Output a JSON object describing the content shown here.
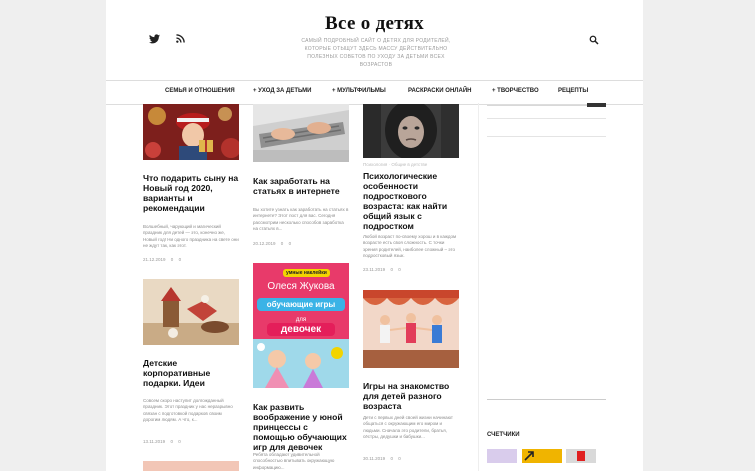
{
  "site": {
    "title": "Все о детях",
    "tagline": "Самый подробный сайт о детях для родителей, которые отыщут здесь массу действительно полезных советов по уходу за детьми всех возрастов"
  },
  "header_icons": [
    "twitter-icon",
    "rss-icon",
    "search-icon"
  ],
  "nav": [
    "Семья и отношения",
    "+ Уход за детьми",
    "+ Мультфильмы",
    "Раскраски онлайн",
    "+ Творчество",
    "Рецепты"
  ],
  "cards": [
    {
      "category": "",
      "title": "Что подарить сыну на Новый год 2020, варианты и рекомендации",
      "excerpt": "Волшебный, чарующий и магический праздник для детей — это, конечно же, Новый год! Ни одного праздника на свете они не ждут так, как этот.",
      "date": "21.12.2019",
      "comments": "0",
      "likes": "0"
    },
    {
      "category": "",
      "title": "Как заработать на статьях в интернете",
      "excerpt": "Вы хотите узнать как заработать на статьях в интернете? Этот пост для вас. Сегодня рассмотрим несколько способов заработка на статьях в...",
      "date": "20.12.2019",
      "comments": "0",
      "likes": "0"
    },
    {
      "category": "Психология · Общие в детстве",
      "title": "Психологические особенности подросткового возраста: как найти общий язык с подростком",
      "excerpt": "Любой возраст по-своему хорош и в каждом возрасте есть своя сложность. С точки зрения родителей, наиболее сложный – это подростковый язык.",
      "date": "23.11.2019",
      "comments": "0",
      "likes": "0"
    },
    {
      "category": "",
      "title": "Детские корпоративные подарки. Идеи",
      "excerpt": "Совсем скоро наступит долгожданный праздник. Этот праздник у нас неразрывно связан с подготовкой подарков своим дорогим людям. А что, к...",
      "date": "13.11.2019",
      "comments": "0",
      "likes": "0"
    },
    {
      "category": "",
      "title": "Как развить воображение у юной принцессы с помощью обучающих игр для девочек",
      "excerpt": "Ребята обладают удивительной способностью впитывать окружающую информацию...",
      "date": "",
      "comments": "",
      "likes": ""
    },
    {
      "category": "",
      "title": "Игры на знакомство для детей разного возраста",
      "excerpt": "Дети с первых дней своей жизни начинают общаться с окружающим его миром и людьми. Сначала это родители, братья, сёстры, дедушки и бабушки...",
      "date": "30.11.2019",
      "comments": "0",
      "likes": "0"
    }
  ],
  "book_cover": {
    "top": "умные наклейки",
    "author": "Олеся Жукова",
    "line1": "обучающие игры",
    "line2": "для",
    "line3": "девочек"
  },
  "sidebar": {
    "counters_title": "Счетчики"
  },
  "colors": {
    "accent": "#222222",
    "meta": "#999999"
  }
}
